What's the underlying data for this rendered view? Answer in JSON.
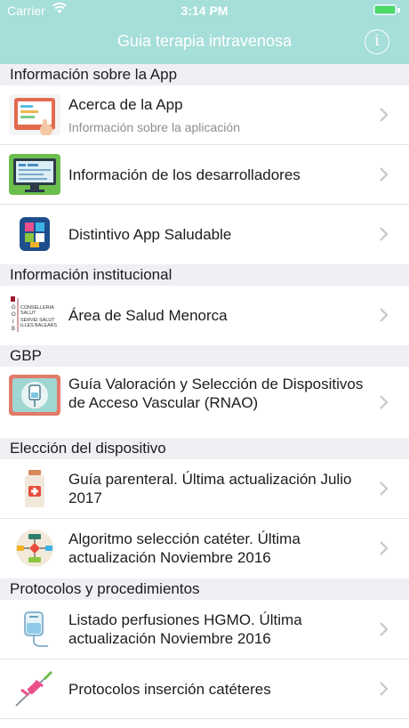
{
  "status_bar": {
    "carrier": "Carrier",
    "time": "3:14 PM",
    "wifi_icon": "wifi-icon",
    "battery_icon": "battery-icon"
  },
  "nav": {
    "title": "Guia terapia intravenosa",
    "info_glyph": "i",
    "info_icon": "info-icon",
    "bar_color": "#a6ded9"
  },
  "sections": [
    {
      "header": "Información sobre la App",
      "items": [
        {
          "title": "Acerca de la App",
          "subtitle": "Información sobre la aplicación",
          "icon": "tablet-hand-icon"
        },
        {
          "title": "Información de los desarrolladores",
          "icon": "developer-monitor-icon"
        },
        {
          "title": "Distintivo App Saludable",
          "icon": "healthy-app-badge-icon"
        }
      ]
    },
    {
      "header": "Información institucional",
      "items": [
        {
          "title": "Área de Salud Menorca",
          "icon": "goib-logo-icon",
          "logo_text": [
            "G",
            "O",
            "I",
            "B",
            "CONSELLERIA",
            "SALUT",
            "SERVEI SALUT",
            "ILLES BALEARS"
          ]
        }
      ]
    },
    {
      "header": "GBP",
      "items": [
        {
          "title": "Guía Valoración y Selección de Dispositivos de Acceso Vascular (RNAO)",
          "icon": "iv-bag-icon"
        }
      ]
    },
    {
      "header": "Elección del dispositivo",
      "items": [
        {
          "title": "Guía parenteral. Última actualización Julio 2017",
          "icon": "parenteral-bottle-icon"
        },
        {
          "title": "Algoritmo selección catéter. Última actualización Noviembre 2016",
          "icon": "flowchart-icon"
        }
      ]
    },
    {
      "header": "Protocolos y procedimientos",
      "items": [
        {
          "title": "Listado perfusiones HGMO. Última actualización Noviembre 2016",
          "icon": "infusion-bag-icon"
        },
        {
          "title": "Protocolos inserción catéteres",
          "icon": "catheter-icon"
        }
      ]
    }
  ],
  "chevron_icon": "chevron-right-icon"
}
